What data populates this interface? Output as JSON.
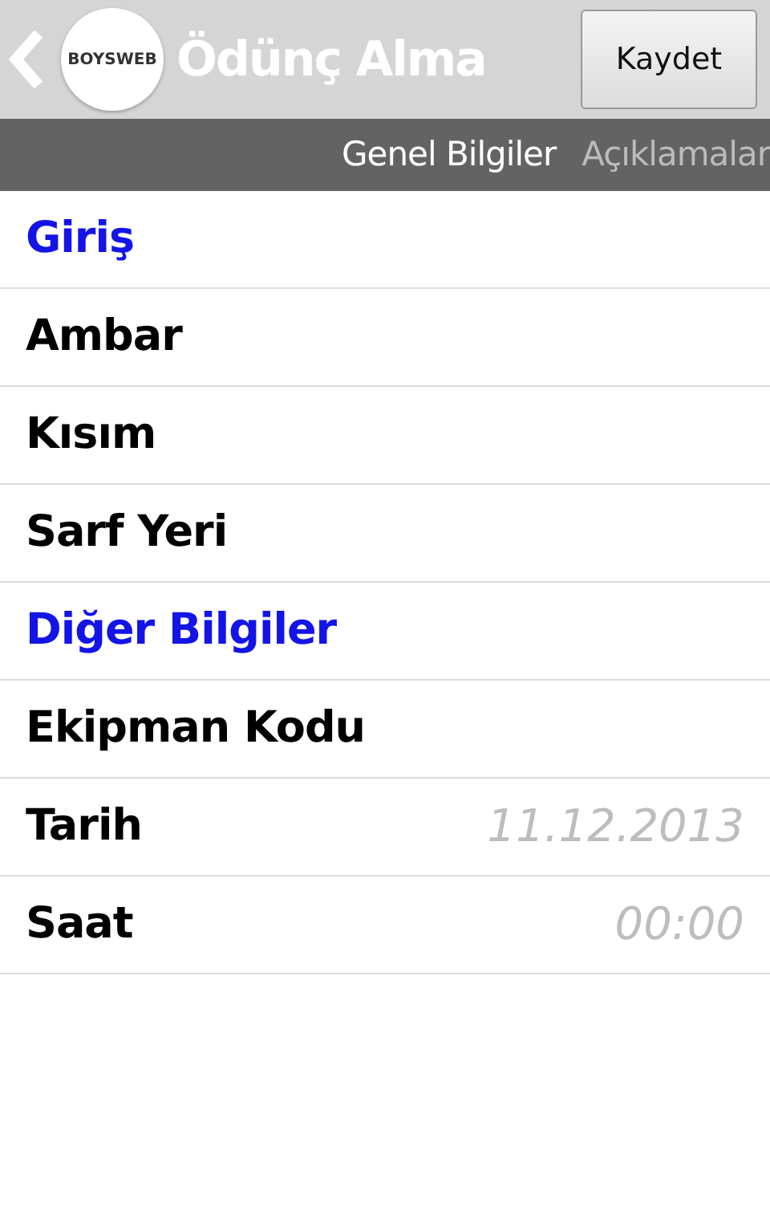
{
  "header": {
    "logo": "BOYSWEB",
    "title": "Ödünç Alma",
    "save_button": "Kaydet"
  },
  "tabs": [
    {
      "label": "Genel Bilgiler",
      "selected": true
    },
    {
      "label": "Açıklamalar",
      "selected": false
    }
  ],
  "rows": [
    {
      "kind": "section",
      "label": "Giriş"
    },
    {
      "kind": "field",
      "label": "Ambar"
    },
    {
      "kind": "field",
      "label": "Kısım"
    },
    {
      "kind": "field",
      "label": "Sarf Yeri"
    },
    {
      "kind": "section",
      "label": "Diğer Bilgiler"
    },
    {
      "kind": "field",
      "label": "Ekipman Kodu"
    },
    {
      "kind": "field",
      "label": "Tarih",
      "placeholder": "11.12.2013"
    },
    {
      "kind": "field",
      "label": "Saat",
      "placeholder": "00:00"
    }
  ]
}
